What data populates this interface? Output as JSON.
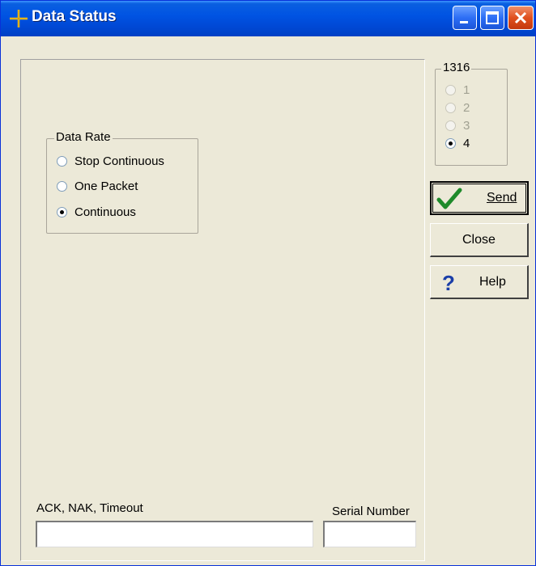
{
  "window": {
    "title": "Data Status",
    "accent": "#0054e3",
    "icon": "crosshair-icon"
  },
  "device_group": {
    "label": "1316",
    "options": [
      {
        "label": "1",
        "checked": false,
        "disabled": true
      },
      {
        "label": "2",
        "checked": false,
        "disabled": true
      },
      {
        "label": "3",
        "checked": false,
        "disabled": true
      },
      {
        "label": "4",
        "checked": true,
        "disabled": false
      }
    ]
  },
  "data_rate": {
    "label": "Data Rate",
    "options": [
      {
        "label": "Stop Continuous",
        "checked": false
      },
      {
        "label": "One Packet",
        "checked": false
      },
      {
        "label": "Continuous",
        "checked": true
      }
    ]
  },
  "buttons": {
    "send_label": "Send",
    "close_label": "Close",
    "help_label": "Help"
  },
  "fields": {
    "status_label": "ACK, NAK, Timeout",
    "status_value": "",
    "serial_label": "Serial Number",
    "serial_value": ""
  }
}
